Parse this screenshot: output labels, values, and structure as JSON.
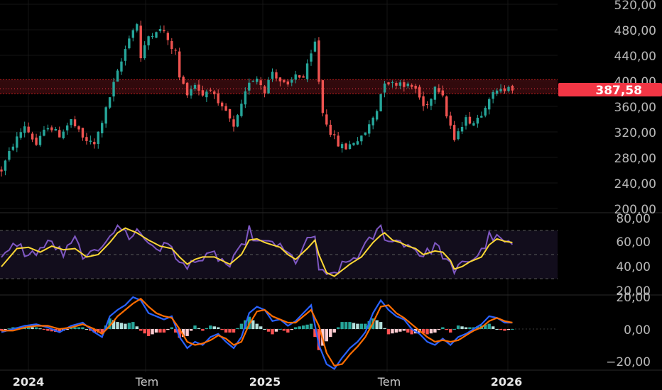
{
  "colors": {
    "background": "#000000",
    "grid": "#151515",
    "up": "#26a69a",
    "down": "#ef5350",
    "rsi_line": "#7e57c2",
    "rsi_ma": "#fdd835",
    "rsi_band": "#120d1c",
    "macd_line": "#2962ff",
    "signal_line": "#ff6d00",
    "hist_up_strong": "#26a69a",
    "hist_up_weak": "#b2dfdb",
    "hist_down_strong": "#ff5252",
    "hist_down_weak": "#ffcdd2",
    "zone_fill": "#3a0a0e",
    "zone_line": "#b71c1c",
    "badge": "#f23645"
  },
  "price_axis": {
    "ticks": [
      "520,00",
      "480,00",
      "440,00",
      "400,00",
      "360,00",
      "320,00",
      "280,00",
      "240,00",
      "200,00"
    ]
  },
  "rsi_axis": {
    "ticks": [
      "80,00",
      "60,00",
      "40,00",
      "20,00"
    ]
  },
  "macd_axis": {
    "ticks": [
      "20,00",
      "0,00",
      "−20,00"
    ]
  },
  "current_price_badge": "387,58",
  "time_axis": {
    "labels": [
      {
        "text": "2024",
        "bold": true
      },
      {
        "text": "Tem",
        "bold": false
      },
      {
        "text": "2025",
        "bold": true
      },
      {
        "text": "Tem",
        "bold": false
      },
      {
        "text": "2026",
        "bold": true
      }
    ]
  },
  "chart_data": {
    "type": "candlestick",
    "panes": [
      "price",
      "rsi",
      "macd"
    ],
    "price_ylim": [
      200,
      520
    ],
    "rsi_ylim": [
      20,
      80
    ],
    "macd_ylim": [
      -20,
      20
    ],
    "resistance_zone": [
      380,
      402
    ],
    "last_price": 387.58,
    "price_path": [
      [
        0,
        260
      ],
      [
        3,
        300
      ],
      [
        6,
        330
      ],
      [
        9,
        300
      ],
      [
        12,
        330
      ],
      [
        15,
        315
      ],
      [
        18,
        338
      ],
      [
        21,
        310
      ],
      [
        24,
        300
      ],
      [
        27,
        355
      ],
      [
        29,
        395
      ],
      [
        31,
        430
      ],
      [
        33,
        470
      ],
      [
        35,
        490
      ],
      [
        36,
        435
      ],
      [
        38,
        470
      ],
      [
        40,
        480
      ],
      [
        42,
        478
      ],
      [
        43,
        460
      ],
      [
        45,
        445
      ],
      [
        46,
        405
      ],
      [
        48,
        382
      ],
      [
        50,
        395
      ],
      [
        52,
        378
      ],
      [
        54,
        390
      ],
      [
        56,
        360
      ],
      [
        58,
        352
      ],
      [
        60,
        325
      ],
      [
        62,
        360
      ],
      [
        64,
        400
      ],
      [
        66,
        405
      ],
      [
        68,
        385
      ],
      [
        70,
        415
      ],
      [
        72,
        400
      ],
      [
        74,
        390
      ],
      [
        76,
        410
      ],
      [
        78,
        405
      ],
      [
        80,
        440
      ],
      [
        81,
        460
      ],
      [
        82,
        400
      ],
      [
        83,
        350
      ],
      [
        85,
        320
      ],
      [
        87,
        300
      ],
      [
        89,
        295
      ],
      [
        91,
        305
      ],
      [
        93,
        310
      ],
      [
        95,
        330
      ],
      [
        97,
        355
      ],
      [
        98,
        380
      ],
      [
        99,
        400
      ],
      [
        101,
        395
      ],
      [
        103,
        398
      ],
      [
        105,
        392
      ],
      [
        107,
        388
      ],
      [
        109,
        360
      ],
      [
        111,
        372
      ],
      [
        112,
        395
      ],
      [
        114,
        380
      ],
      [
        115,
        345
      ],
      [
        116,
        330
      ],
      [
        117,
        303
      ],
      [
        118,
        325
      ],
      [
        120,
        340
      ],
      [
        122,
        335
      ],
      [
        124,
        350
      ],
      [
        126,
        375
      ],
      [
        128,
        382
      ],
      [
        130,
        387
      ],
      [
        131,
        395
      ],
      [
        132,
        387.58
      ]
    ],
    "rsi_path": [
      [
        0,
        45
      ],
      [
        4,
        60
      ],
      [
        7,
        48
      ],
      [
        10,
        55
      ],
      [
        13,
        60
      ],
      [
        16,
        50
      ],
      [
        19,
        62
      ],
      [
        22,
        45
      ],
      [
        25,
        55
      ],
      [
        28,
        68
      ],
      [
        31,
        72
      ],
      [
        33,
        65
      ],
      [
        35,
        70
      ],
      [
        38,
        60
      ],
      [
        41,
        55
      ],
      [
        44,
        58
      ],
      [
        46,
        42
      ],
      [
        48,
        38
      ],
      [
        50,
        48
      ],
      [
        52,
        45
      ],
      [
        55,
        50
      ],
      [
        57,
        45
      ],
      [
        59,
        40
      ],
      [
        62,
        55
      ],
      [
        64,
        70
      ],
      [
        66,
        60
      ],
      [
        68,
        58
      ],
      [
        70,
        62
      ],
      [
        72,
        55
      ],
      [
        74,
        50
      ],
      [
        76,
        45
      ],
      [
        79,
        60
      ],
      [
        81,
        66
      ],
      [
        82,
        38
      ],
      [
        84,
        30
      ],
      [
        86,
        35
      ],
      [
        88,
        40
      ],
      [
        90,
        45
      ],
      [
        93,
        52
      ],
      [
        96,
        65
      ],
      [
        98,
        72
      ],
      [
        99,
        66
      ],
      [
        101,
        60
      ],
      [
        103,
        62
      ],
      [
        105,
        58
      ],
      [
        107,
        55
      ],
      [
        109,
        48
      ],
      [
        112,
        58
      ],
      [
        114,
        50
      ],
      [
        116,
        40
      ],
      [
        117,
        32
      ],
      [
        119,
        46
      ],
      [
        121,
        45
      ],
      [
        124,
        52
      ],
      [
        126,
        65
      ],
      [
        128,
        63
      ],
      [
        130,
        60
      ],
      [
        132,
        58
      ]
    ],
    "rsi_ma_path": [
      [
        0,
        40
      ],
      [
        4,
        55
      ],
      [
        7,
        56
      ],
      [
        10,
        52
      ],
      [
        13,
        57
      ],
      [
        16,
        54
      ],
      [
        19,
        55
      ],
      [
        22,
        48
      ],
      [
        25,
        50
      ],
      [
        28,
        60
      ],
      [
        30,
        68
      ],
      [
        32,
        72
      ],
      [
        35,
        68
      ],
      [
        38,
        62
      ],
      [
        41,
        57
      ],
      [
        44,
        55
      ],
      [
        46,
        48
      ],
      [
        48,
        42
      ],
      [
        50,
        46
      ],
      [
        52,
        48
      ],
      [
        55,
        48
      ],
      [
        57,
        45
      ],
      [
        59,
        42
      ],
      [
        62,
        50
      ],
      [
        64,
        62
      ],
      [
        66,
        63
      ],
      [
        68,
        60
      ],
      [
        70,
        58
      ],
      [
        72,
        56
      ],
      [
        74,
        50
      ],
      [
        76,
        46
      ],
      [
        79,
        55
      ],
      [
        81,
        62
      ],
      [
        82,
        50
      ],
      [
        84,
        35
      ],
      [
        86,
        32
      ],
      [
        88,
        37
      ],
      [
        90,
        42
      ],
      [
        93,
        48
      ],
      [
        96,
        60
      ],
      [
        98,
        66
      ],
      [
        99,
        68
      ],
      [
        101,
        62
      ],
      [
        103,
        60
      ],
      [
        105,
        57
      ],
      [
        107,
        55
      ],
      [
        109,
        50
      ],
      [
        112,
        53
      ],
      [
        114,
        52
      ],
      [
        116,
        45
      ],
      [
        117,
        38
      ],
      [
        119,
        40
      ],
      [
        121,
        44
      ],
      [
        124,
        48
      ],
      [
        126,
        58
      ],
      [
        128,
        63
      ],
      [
        130,
        61
      ],
      [
        132,
        60
      ]
    ],
    "macd_path": [
      [
        0,
        -2
      ],
      [
        3,
        0
      ],
      [
        6,
        2
      ],
      [
        9,
        3
      ],
      [
        12,
        1
      ],
      [
        15,
        -2
      ],
      [
        18,
        2
      ],
      [
        21,
        4
      ],
      [
        24,
        -2
      ],
      [
        26,
        -5
      ],
      [
        28,
        8
      ],
      [
        30,
        12
      ],
      [
        32,
        15
      ],
      [
        34,
        20
      ],
      [
        36,
        18
      ],
      [
        38,
        10
      ],
      [
        40,
        8
      ],
      [
        42,
        6
      ],
      [
        44,
        8
      ],
      [
        46,
        -5
      ],
      [
        48,
        -12
      ],
      [
        50,
        -8
      ],
      [
        52,
        -10
      ],
      [
        54,
        -5
      ],
      [
        56,
        -3
      ],
      [
        58,
        -8
      ],
      [
        60,
        -12
      ],
      [
        62,
        -5
      ],
      [
        64,
        10
      ],
      [
        66,
        14
      ],
      [
        68,
        12
      ],
      [
        70,
        5
      ],
      [
        72,
        6
      ],
      [
        74,
        2
      ],
      [
        76,
        5
      ],
      [
        78,
        10
      ],
      [
        80,
        15
      ],
      [
        82,
        -10
      ],
      [
        84,
        -22
      ],
      [
        86,
        -25
      ],
      [
        88,
        -18
      ],
      [
        90,
        -12
      ],
      [
        92,
        -8
      ],
      [
        94,
        -2
      ],
      [
        96,
        10
      ],
      [
        98,
        18
      ],
      [
        100,
        12
      ],
      [
        102,
        8
      ],
      [
        104,
        6
      ],
      [
        106,
        0
      ],
      [
        108,
        -3
      ],
      [
        110,
        -8
      ],
      [
        112,
        -10
      ],
      [
        114,
        -6
      ],
      [
        116,
        -10
      ],
      [
        118,
        -5
      ],
      [
        120,
        -3
      ],
      [
        122,
        0
      ],
      [
        124,
        3
      ],
      [
        126,
        8
      ],
      [
        128,
        7
      ],
      [
        130,
        4
      ],
      [
        132,
        4
      ]
    ],
    "signal_path": [
      [
        0,
        -1
      ],
      [
        3,
        -1
      ],
      [
        6,
        1
      ],
      [
        9,
        2
      ],
      [
        12,
        2
      ],
      [
        15,
        0
      ],
      [
        18,
        1
      ],
      [
        21,
        3
      ],
      [
        24,
        0
      ],
      [
        26,
        -3
      ],
      [
        28,
        2
      ],
      [
        30,
        8
      ],
      [
        32,
        12
      ],
      [
        34,
        16
      ],
      [
        36,
        19
      ],
      [
        38,
        14
      ],
      [
        40,
        10
      ],
      [
        42,
        8
      ],
      [
        44,
        7
      ],
      [
        46,
        0
      ],
      [
        48,
        -8
      ],
      [
        50,
        -10
      ],
      [
        52,
        -9
      ],
      [
        54,
        -7
      ],
      [
        56,
        -4
      ],
      [
        58,
        -6
      ],
      [
        60,
        -10
      ],
      [
        62,
        -8
      ],
      [
        64,
        3
      ],
      [
        66,
        11
      ],
      [
        68,
        12
      ],
      [
        70,
        8
      ],
      [
        72,
        6
      ],
      [
        74,
        4
      ],
      [
        76,
        4
      ],
      [
        78,
        8
      ],
      [
        80,
        12
      ],
      [
        82,
        2
      ],
      [
        84,
        -15
      ],
      [
        86,
        -23
      ],
      [
        88,
        -22
      ],
      [
        90,
        -16
      ],
      [
        92,
        -11
      ],
      [
        94,
        -5
      ],
      [
        96,
        4
      ],
      [
        98,
        14
      ],
      [
        100,
        15
      ],
      [
        102,
        10
      ],
      [
        104,
        7
      ],
      [
        106,
        3
      ],
      [
        108,
        -1
      ],
      [
        110,
        -5
      ],
      [
        112,
        -8
      ],
      [
        114,
        -7
      ],
      [
        116,
        -8
      ],
      [
        118,
        -7
      ],
      [
        120,
        -4
      ],
      [
        122,
        -1
      ],
      [
        124,
        1
      ],
      [
        126,
        5
      ],
      [
        128,
        7
      ],
      [
        130,
        5
      ],
      [
        132,
        4
      ]
    ]
  }
}
